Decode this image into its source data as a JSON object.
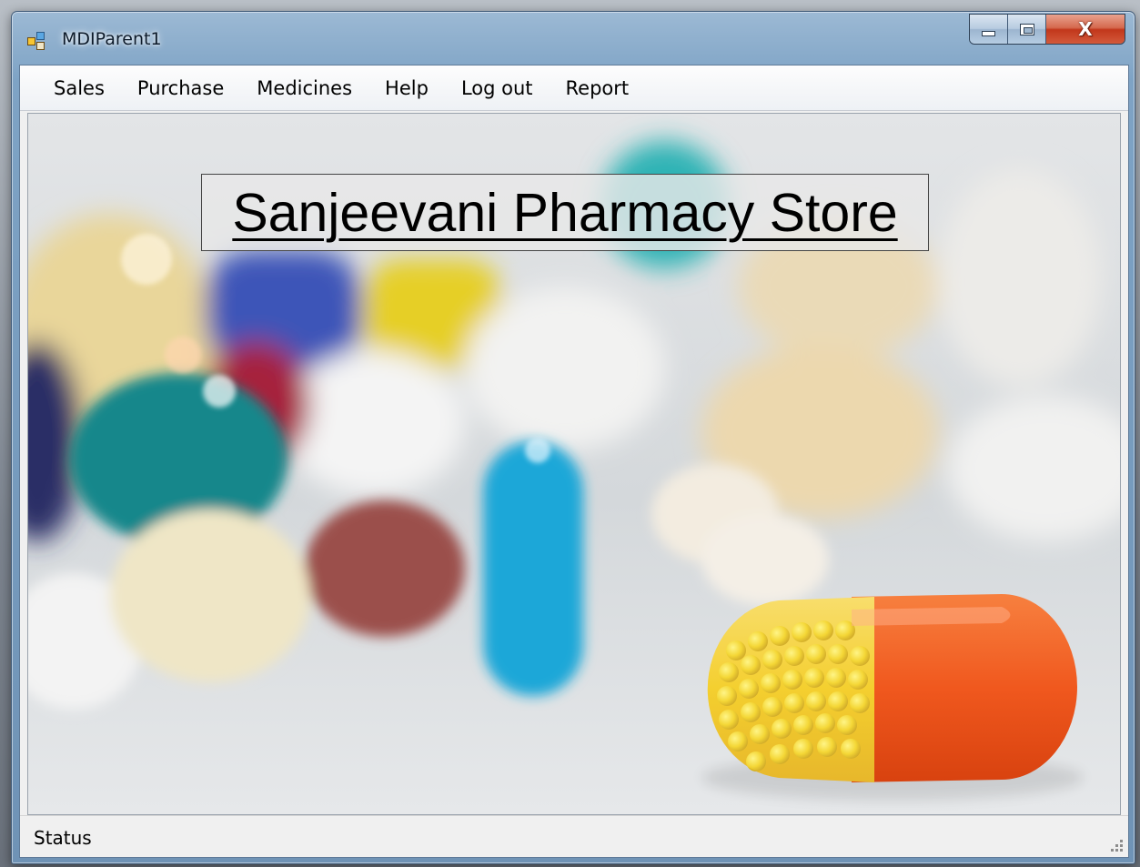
{
  "window": {
    "title": "MDIParent1",
    "app_icon": "mdi-form-icon",
    "controls": {
      "minimize_icon": "minimize-icon",
      "maximize_icon": "maximize-icon",
      "close_icon": "close-icon",
      "close_glyph": "X"
    }
  },
  "menubar": {
    "items": [
      {
        "label": "Sales"
      },
      {
        "label": "Purchase"
      },
      {
        "label": "Medicines"
      },
      {
        "label": "Help"
      },
      {
        "label": "Log out"
      },
      {
        "label": "Report"
      }
    ]
  },
  "main": {
    "heading": "Sanjeevani Pharmacy Store",
    "background_image": "blurred-pills-photo"
  },
  "statusbar": {
    "label": "Status",
    "grip_icon": "size-grip-icon"
  },
  "colors": {
    "frame": "#7ea3c5",
    "close_button": "#c2371b",
    "menubar": "#fdfdfd",
    "capsule_yellow": "#f2c60f",
    "capsule_orange": "#f0581e"
  }
}
